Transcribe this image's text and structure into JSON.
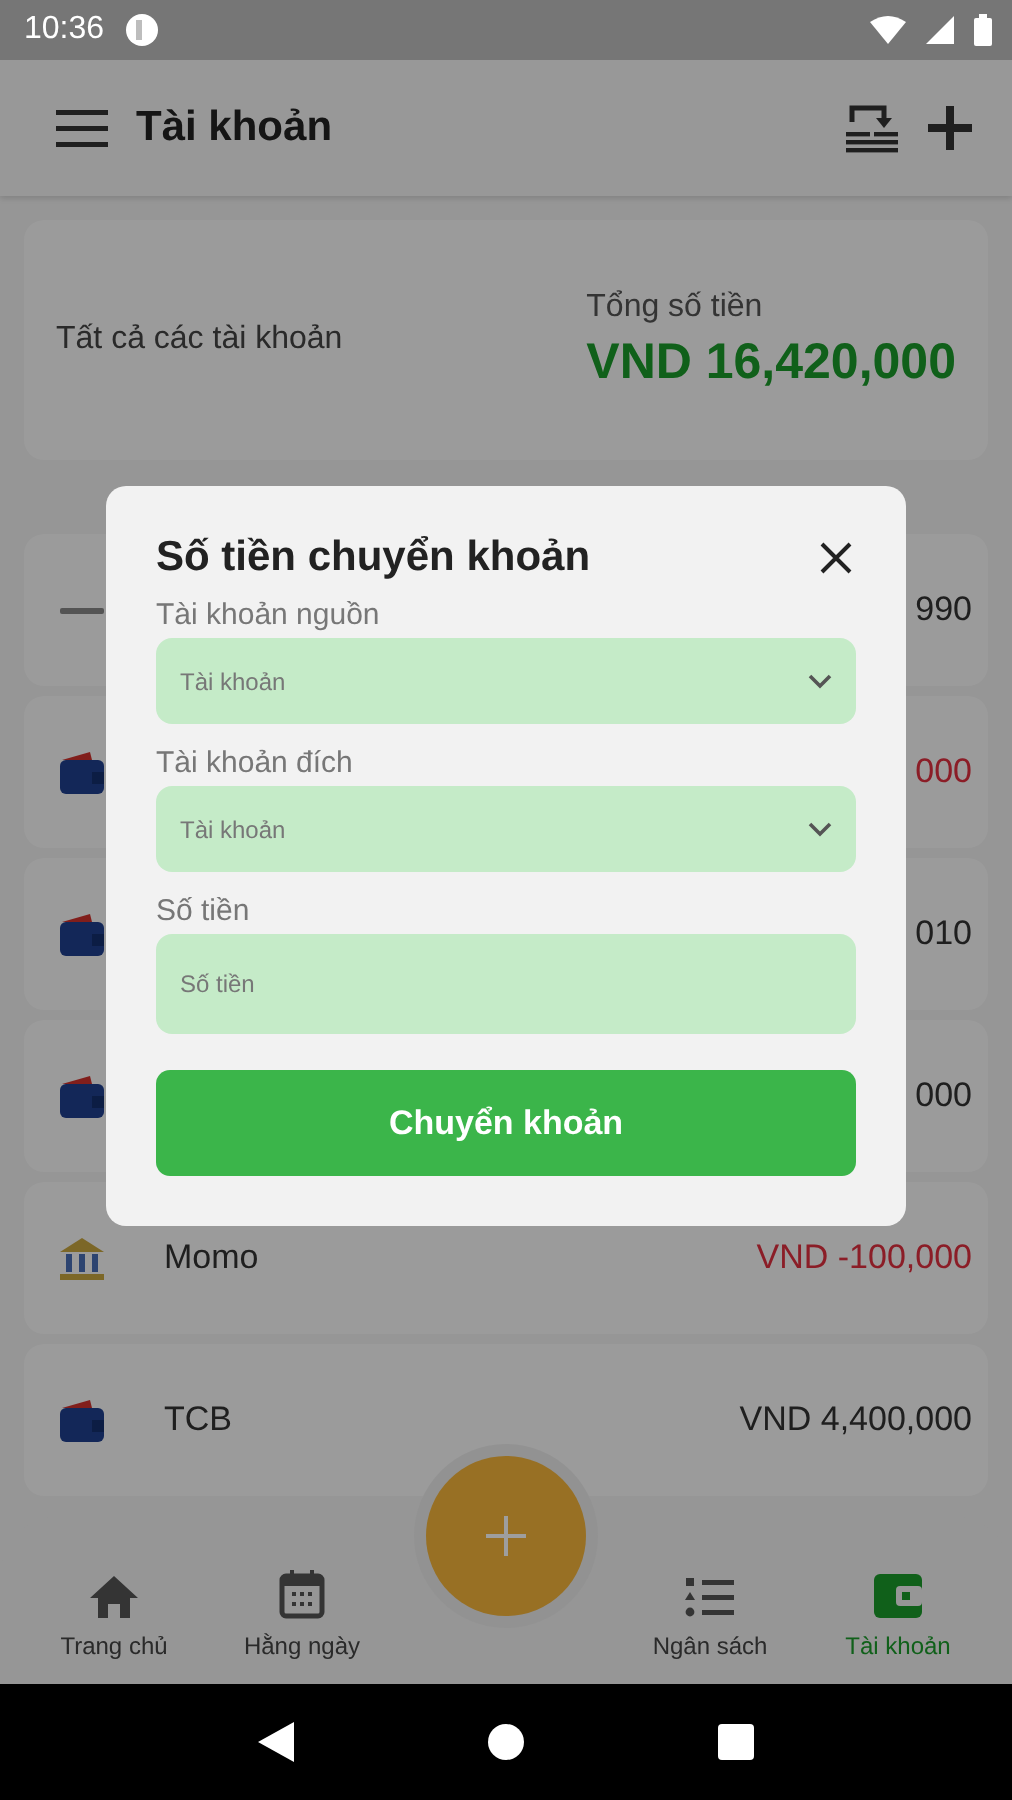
{
  "status_bar": {
    "time": "10:36"
  },
  "app_bar": {
    "title": "Tài khoản"
  },
  "summary": {
    "label": "Tất cả các tài khoản",
    "total_label": "Tổng số tiền",
    "total": "VND 16,420,000"
  },
  "accounts": [
    {
      "kind": "logo",
      "amount": "990",
      "negative": false
    },
    {
      "kind": "wallet",
      "amount": "000",
      "negative": true
    },
    {
      "kind": "wallet",
      "amount": "010",
      "negative": false
    },
    {
      "kind": "wallet",
      "amount": "000",
      "negative": false
    },
    {
      "kind": "bank",
      "name": "Momo",
      "amount": "VND -100,000",
      "negative": true
    },
    {
      "kind": "wallet",
      "name": "TCB",
      "amount": "VND 4,400,000",
      "negative": false
    }
  ],
  "dialog": {
    "title": "Số tiền chuyển khoản",
    "fields": [
      {
        "kind": "select",
        "label": "Tài khoản nguồn",
        "placeholder": "Tài khoản"
      },
      {
        "kind": "select",
        "label": "Tài khoản đích",
        "placeholder": "Tài khoản"
      },
      {
        "kind": "text",
        "label": "Số tiền",
        "placeholder": "Số tiền"
      }
    ],
    "button": "Chuyển khoản"
  },
  "bottom_nav": [
    {
      "label": "Trang chủ",
      "selected": false
    },
    {
      "label": "Hằng ngày",
      "selected": false
    },
    {
      "label": "Ngân sách",
      "selected": false
    },
    {
      "label": "Tài khoản",
      "selected": true
    }
  ]
}
